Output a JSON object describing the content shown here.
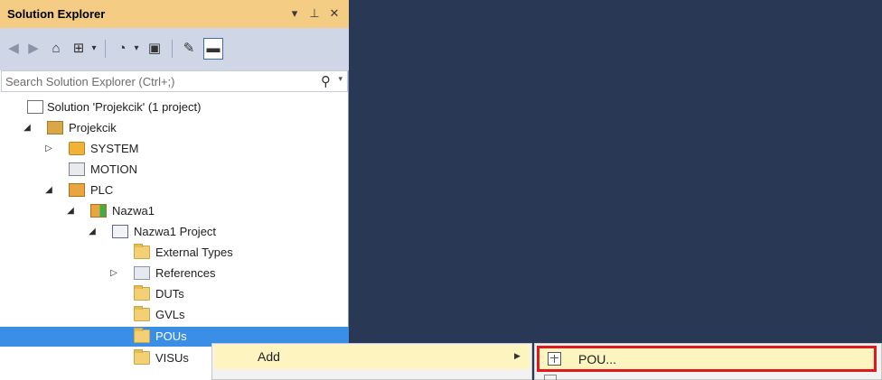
{
  "panel": {
    "title": "Solution Explorer",
    "buttons": {
      "dropdown": "▾",
      "pin": "⊥",
      "close": "✕"
    }
  },
  "toolbar": {
    "items": [
      {
        "name": "back-icon",
        "glyph": "◀"
      },
      {
        "name": "forward-icon",
        "glyph": "▶"
      },
      {
        "name": "home-icon",
        "glyph": "⌂"
      },
      {
        "name": "switch-views-icon",
        "glyph": "⊞"
      },
      {
        "name": "pending-changes-icon",
        "glyph": "◔"
      },
      {
        "name": "collapse-all-icon",
        "glyph": "▣"
      },
      {
        "name": "properties-icon",
        "glyph": "✎"
      },
      {
        "name": "preview-icon",
        "glyph": "▬"
      }
    ]
  },
  "search": {
    "placeholder": "Search Solution Explorer (Ctrl+;)"
  },
  "tree": [
    {
      "label": "Solution 'Projekcik' (1 project)",
      "icon": "solution-icon",
      "depth": 0,
      "arrow": ""
    },
    {
      "label": "Projekcik",
      "icon": "project-icon",
      "depth": 1,
      "arrow": "◢"
    },
    {
      "label": "SYSTEM",
      "icon": "system-icon",
      "depth": 2,
      "arrow": "▷"
    },
    {
      "label": "MOTION",
      "icon": "motion-icon",
      "depth": 2,
      "arrow": ""
    },
    {
      "label": "PLC",
      "icon": "plc-icon",
      "depth": 2,
      "arrow": "◢"
    },
    {
      "label": "Nazwa1",
      "icon": "plc-project-icon",
      "depth": 3,
      "arrow": "◢"
    },
    {
      "label": "Nazwa1 Project",
      "icon": "project-file-icon",
      "depth": 4,
      "arrow": "◢"
    },
    {
      "label": "External Types",
      "icon": "folder-icon",
      "depth": 5,
      "arrow": ""
    },
    {
      "label": "References",
      "icon": "references-icon",
      "depth": 5,
      "arrow": "▷"
    },
    {
      "label": "DUTs",
      "icon": "folder-icon",
      "depth": 5,
      "arrow": ""
    },
    {
      "label": "GVLs",
      "icon": "folder-icon",
      "depth": 5,
      "arrow": ""
    },
    {
      "label": "POUs",
      "icon": "folder-icon",
      "depth": 5,
      "arrow": "",
      "selected": true
    },
    {
      "label": "VISUs",
      "icon": "folder-icon",
      "depth": 5,
      "arrow": ""
    }
  ],
  "context_menu": {
    "add_label": "Add",
    "submenu_arrow": "▶"
  },
  "submenu": {
    "pou_label": "POU..."
  },
  "colors": {
    "background": "#293955",
    "title_bar": "#f5cc84",
    "toolbar": "#cfd6e5",
    "selection": "#3a8ee6",
    "menu_hover": "#fdf4bf",
    "highlight_border": "#e0191d"
  }
}
